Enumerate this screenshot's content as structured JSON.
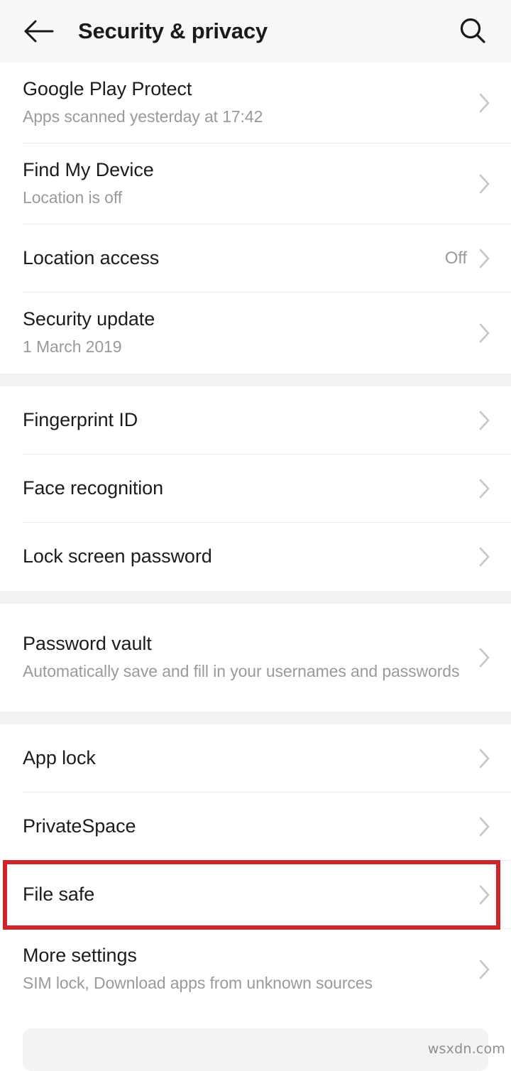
{
  "header": {
    "title": "Security & privacy",
    "back_icon": "arrow-left-icon",
    "search_icon": "search-icon"
  },
  "groups": [
    {
      "id": "group-status",
      "rows": [
        {
          "name": "google-play-protect",
          "title": "Google Play Protect",
          "subtitle": "Apps scanned yesterday at 17:42",
          "value": "",
          "lines": 2
        },
        {
          "name": "find-my-device",
          "title": "Find My Device",
          "subtitle": "Location is off",
          "value": "",
          "lines": 2
        },
        {
          "name": "location-access",
          "title": "Location access",
          "subtitle": "",
          "value": "Off",
          "lines": 1
        },
        {
          "name": "security-update",
          "title": "Security update",
          "subtitle": "1 March 2019",
          "value": "",
          "lines": 2
        }
      ]
    },
    {
      "id": "group-biometrics",
      "rows": [
        {
          "name": "fingerprint-id",
          "title": "Fingerprint ID",
          "subtitle": "",
          "value": "",
          "lines": 1
        },
        {
          "name": "face-recognition",
          "title": "Face recognition",
          "subtitle": "",
          "value": "",
          "lines": 1
        },
        {
          "name": "lock-screen-password",
          "title": "Lock screen password",
          "subtitle": "",
          "value": "",
          "lines": 1
        }
      ]
    },
    {
      "id": "group-password-vault",
      "rows": [
        {
          "name": "password-vault",
          "title": "Password vault",
          "subtitle": "Automatically save and fill in your usernames and passwords",
          "value": "",
          "lines": 3
        }
      ]
    },
    {
      "id": "group-privacy",
      "rows": [
        {
          "name": "app-lock",
          "title": "App lock",
          "subtitle": "",
          "value": "",
          "lines": 1
        },
        {
          "name": "private-space",
          "title": "PrivateSpace",
          "subtitle": "",
          "value": "",
          "lines": 1
        },
        {
          "name": "file-safe",
          "title": "File safe",
          "subtitle": "",
          "value": "",
          "lines": 1,
          "highlighted": true
        },
        {
          "name": "more-settings",
          "title": "More settings",
          "subtitle": "SIM lock, Download apps from unknown sources",
          "value": "",
          "lines": 2
        }
      ]
    }
  ],
  "annotation": {
    "target": "file-safe",
    "color": "#d1232a"
  },
  "watermark": "wsxdn.com",
  "colors": {
    "header_bg": "#f7f7f7",
    "page_bg": "#ffffff",
    "gap_bg": "#f2f2f2",
    "title_text": "#1c1c1c",
    "subtitle_text": "#9a9a9a",
    "divider": "#eaeaea",
    "chevron": "#c6c6c6",
    "highlight": "#d1232a"
  }
}
